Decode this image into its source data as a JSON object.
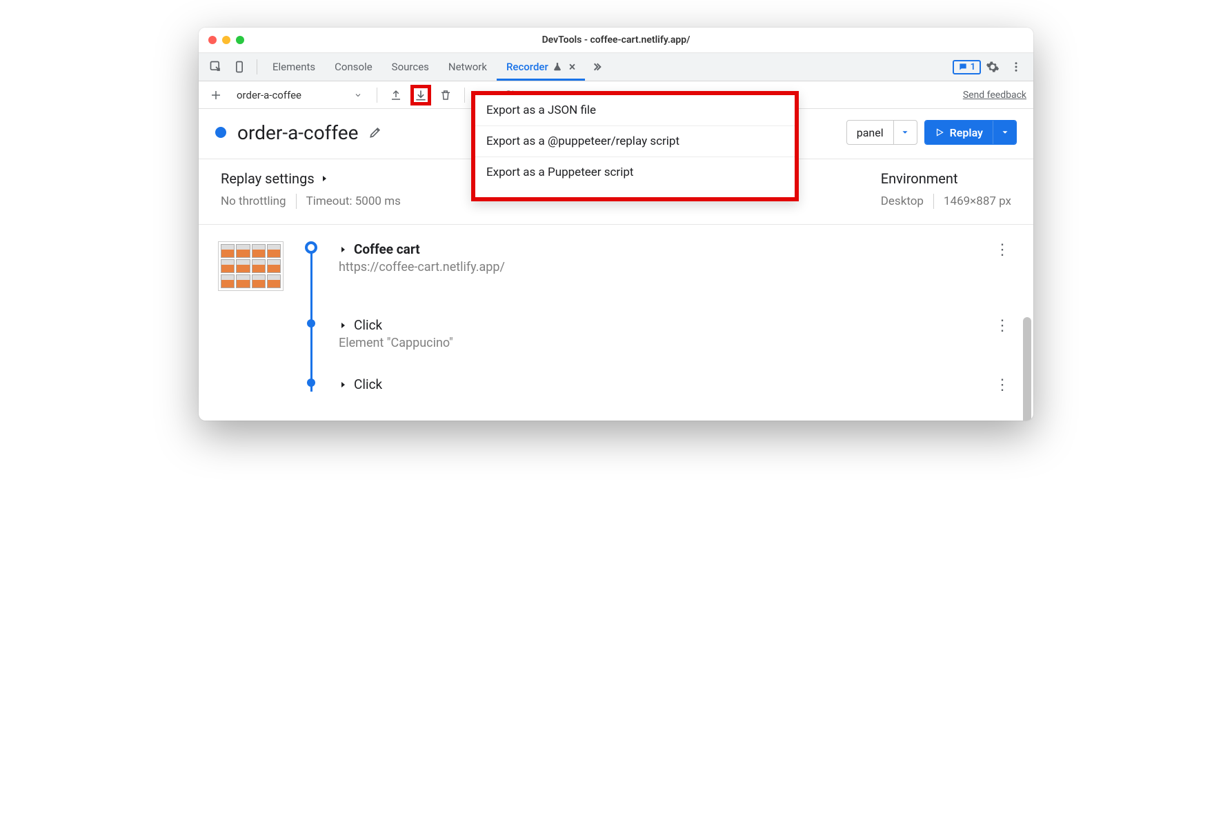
{
  "window": {
    "title": "DevTools - coffee-cart.netlify.app/"
  },
  "tabs": {
    "elements": "Elements",
    "console": "Console",
    "sources": "Sources",
    "network": "Network",
    "recorder": "Recorder",
    "messages_count": "1"
  },
  "toolbar": {
    "recording_name": "order-a-coffee",
    "feedback": "Send feedback"
  },
  "header": {
    "title": "order-a-coffee",
    "panel_button": "panel",
    "replay_button": "Replay"
  },
  "export_menu": {
    "items": [
      "Export as a JSON file",
      "Export as a @puppeteer/replay script",
      "Export as a Puppeteer script"
    ]
  },
  "settings": {
    "replay_label": "Replay settings",
    "throttling": "No throttling",
    "timeout": "Timeout: 5000 ms",
    "env_label": "Environment",
    "device": "Desktop",
    "dimensions": "1469×887 px"
  },
  "steps": [
    {
      "title": "Coffee cart",
      "subtitle": "https://coffee-cart.netlify.app/",
      "bold": true,
      "has_thumb": true,
      "node": "open"
    },
    {
      "title": "Click",
      "subtitle": "Element \"Cappucino\"",
      "bold": false,
      "has_thumb": false,
      "node": "solid"
    },
    {
      "title": "Click",
      "subtitle": "",
      "bold": false,
      "has_thumb": false,
      "node": "solid"
    }
  ]
}
